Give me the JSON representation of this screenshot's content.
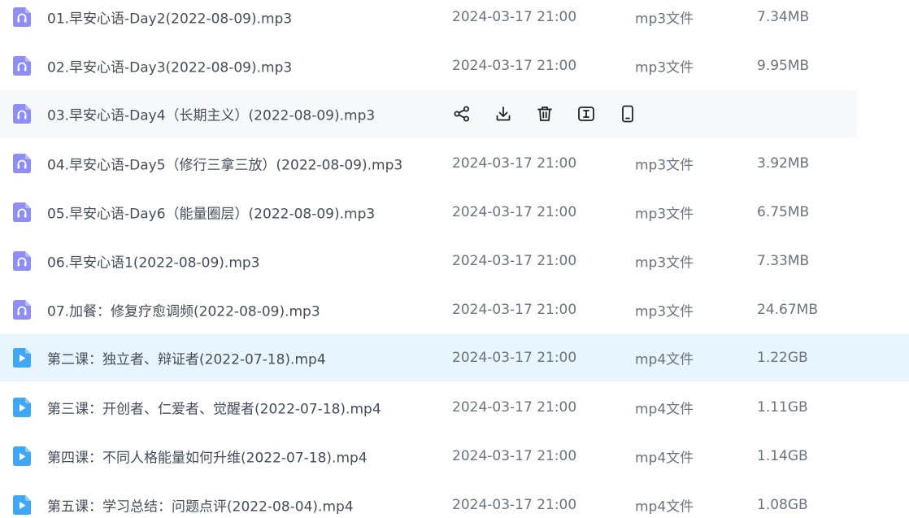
{
  "files": [
    {
      "name": "01.早安心语-Day2(2022-08-09).mp3",
      "date": "2024-03-17 21:00",
      "type": "mp3文件",
      "size": "7.34MB",
      "kind": "audio",
      "state": "normal"
    },
    {
      "name": "02.早安心语-Day3(2022-08-09).mp3",
      "date": "2024-03-17 21:00",
      "type": "mp3文件",
      "size": "9.95MB",
      "kind": "audio",
      "state": "normal"
    },
    {
      "name": "03.早安心语-Day4（长期主义）(2022-08-09).mp3",
      "date": "",
      "type": "",
      "size": "",
      "kind": "audio",
      "state": "hovered"
    },
    {
      "name": "04.早安心语-Day5（修行三拿三放）(2022-08-09).mp3",
      "date": "2024-03-17 21:00",
      "type": "mp3文件",
      "size": "3.92MB",
      "kind": "audio",
      "state": "normal"
    },
    {
      "name": "05.早安心语-Day6（能量圈层）(2022-08-09).mp3",
      "date": "2024-03-17 21:00",
      "type": "mp3文件",
      "size": "6.75MB",
      "kind": "audio",
      "state": "normal"
    },
    {
      "name": "06.早安心语1(2022-08-09).mp3",
      "date": "2024-03-17 21:00",
      "type": "mp3文件",
      "size": "7.33MB",
      "kind": "audio",
      "state": "normal"
    },
    {
      "name": "07.加餐：修复疗愈调频(2022-08-09).mp3",
      "date": "2024-03-17 21:00",
      "type": "mp3文件",
      "size": "24.67MB",
      "kind": "audio",
      "state": "normal"
    },
    {
      "name": "第二课：独立者、辩证者(2022-07-18).mp4",
      "date": "2024-03-17 21:00",
      "type": "mp4文件",
      "size": "1.22GB",
      "kind": "video",
      "state": "selected"
    },
    {
      "name": "第三课：开创者、仁爱者、觉醒者(2022-07-18).mp4",
      "date": "2024-03-17 21:00",
      "type": "mp4文件",
      "size": "1.11GB",
      "kind": "video",
      "state": "normal"
    },
    {
      "name": "第四课：不同人格能量如何升维(2022-07-18).mp4",
      "date": "2024-03-17 21:00",
      "type": "mp4文件",
      "size": "1.14GB",
      "kind": "video",
      "state": "normal"
    },
    {
      "name": "第五课：学习总结：问题点评(2022-08-04).mp4",
      "date": "2024-03-17 21:00",
      "type": "mp4文件",
      "size": "1.08GB",
      "kind": "video",
      "state": "normal"
    }
  ],
  "row_actions": [
    {
      "icon": "share-icon"
    },
    {
      "icon": "download-icon"
    },
    {
      "icon": "delete-icon"
    },
    {
      "icon": "rename-icon"
    },
    {
      "icon": "mobile-icon"
    }
  ],
  "colors": {
    "audio_icon": "#8f8ef5",
    "video_icon": "#3fa7f5",
    "hover_bg": "#f7f8fa",
    "selected_bg": "#e8f4fe",
    "text_primary": "#454d5a",
    "text_secondary": "#6b7380"
  }
}
